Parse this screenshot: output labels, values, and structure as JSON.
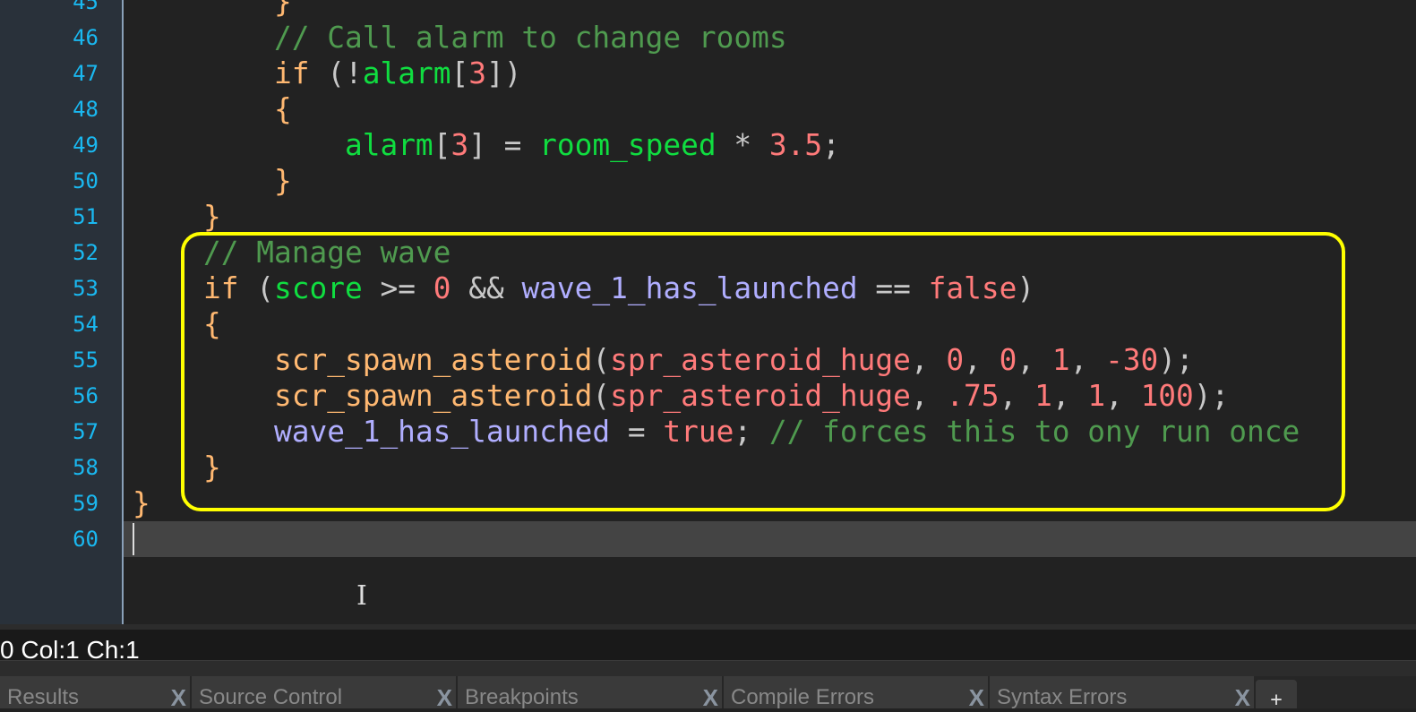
{
  "editor": {
    "line_numbers": [
      "45",
      "46",
      "47",
      "48",
      "49",
      "50",
      "51",
      "52",
      "53",
      "54",
      "55",
      "56",
      "57",
      "58",
      "59",
      "60"
    ],
    "current_line": "60",
    "lines": [
      [
        [
          "        ",
          "df"
        ],
        [
          "}",
          "kw"
        ]
      ],
      [
        [
          "        ",
          "df"
        ],
        [
          "// Call alarm to change rooms",
          "cm"
        ]
      ],
      [
        [
          "        ",
          "df"
        ],
        [
          "if",
          "kw"
        ],
        [
          " (!",
          "df"
        ],
        [
          "alarm",
          "gr"
        ],
        [
          "[",
          "df"
        ],
        [
          "3",
          "nm"
        ],
        [
          "])",
          "df"
        ]
      ],
      [
        [
          "        ",
          "df"
        ],
        [
          "{",
          "kw"
        ]
      ],
      [
        [
          "            ",
          "df"
        ],
        [
          "alarm",
          "gr"
        ],
        [
          "[",
          "df"
        ],
        [
          "3",
          "nm"
        ],
        [
          "] = ",
          "df"
        ],
        [
          "room_speed",
          "gr"
        ],
        [
          " * ",
          "df"
        ],
        [
          "3.5",
          "nm"
        ],
        [
          ";",
          "df"
        ]
      ],
      [
        [
          "        ",
          "df"
        ],
        [
          "}",
          "kw"
        ]
      ],
      [
        [
          "    ",
          "df"
        ],
        [
          "}",
          "kw"
        ]
      ],
      [
        [
          "    ",
          "df"
        ],
        [
          "// Manage wave",
          "cm"
        ]
      ],
      [
        [
          "    ",
          "df"
        ],
        [
          "if",
          "kw"
        ],
        [
          " (",
          "df"
        ],
        [
          "score",
          "gr"
        ],
        [
          " >= ",
          "df"
        ],
        [
          "0",
          "nm"
        ],
        [
          " && ",
          "df"
        ],
        [
          "wave_1_has_launched",
          "lv"
        ],
        [
          " == ",
          "df"
        ],
        [
          "false",
          "nm"
        ],
        [
          ")",
          "df"
        ]
      ],
      [
        [
          "    ",
          "df"
        ],
        [
          "{",
          "kw"
        ]
      ],
      [
        [
          "        ",
          "df"
        ],
        [
          "scr_spawn_asteroid",
          "fn"
        ],
        [
          "(",
          "df"
        ],
        [
          "spr_asteroid_huge",
          "nm"
        ],
        [
          ", ",
          "df"
        ],
        [
          "0",
          "nm"
        ],
        [
          ", ",
          "df"
        ],
        [
          "0",
          "nm"
        ],
        [
          ", ",
          "df"
        ],
        [
          "1",
          "nm"
        ],
        [
          ", ",
          "df"
        ],
        [
          "-30",
          "nm"
        ],
        [
          ");",
          "df"
        ]
      ],
      [
        [
          "        ",
          "df"
        ],
        [
          "scr_spawn_asteroid",
          "fn"
        ],
        [
          "(",
          "df"
        ],
        [
          "spr_asteroid_huge",
          "nm"
        ],
        [
          ", ",
          "df"
        ],
        [
          ".75",
          "nm"
        ],
        [
          ", ",
          "df"
        ],
        [
          "1",
          "nm"
        ],
        [
          ", ",
          "df"
        ],
        [
          "1",
          "nm"
        ],
        [
          ", ",
          "df"
        ],
        [
          "100",
          "nm"
        ],
        [
          ");",
          "df"
        ]
      ],
      [
        [
          "        ",
          "df"
        ],
        [
          "wave_1_has_launched",
          "lv"
        ],
        [
          " = ",
          "df"
        ],
        [
          "true",
          "nm"
        ],
        [
          "; ",
          "df"
        ],
        [
          "// forces this to ony run once",
          "cm"
        ]
      ],
      [
        [
          "    ",
          "df"
        ],
        [
          "}",
          "kw"
        ]
      ],
      [
        [
          "}",
          "kw"
        ]
      ],
      []
    ]
  },
  "highlight_color": "#ffff00",
  "status": {
    "text": "0 Col:1 Ch:1"
  },
  "tabs": [
    {
      "label": "Results"
    },
    {
      "label": "Source Control"
    },
    {
      "label": "Breakpoints"
    },
    {
      "label": "Compile Errors"
    },
    {
      "label": "Syntax Errors"
    }
  ],
  "tab_close": "X",
  "add_tab": "+"
}
